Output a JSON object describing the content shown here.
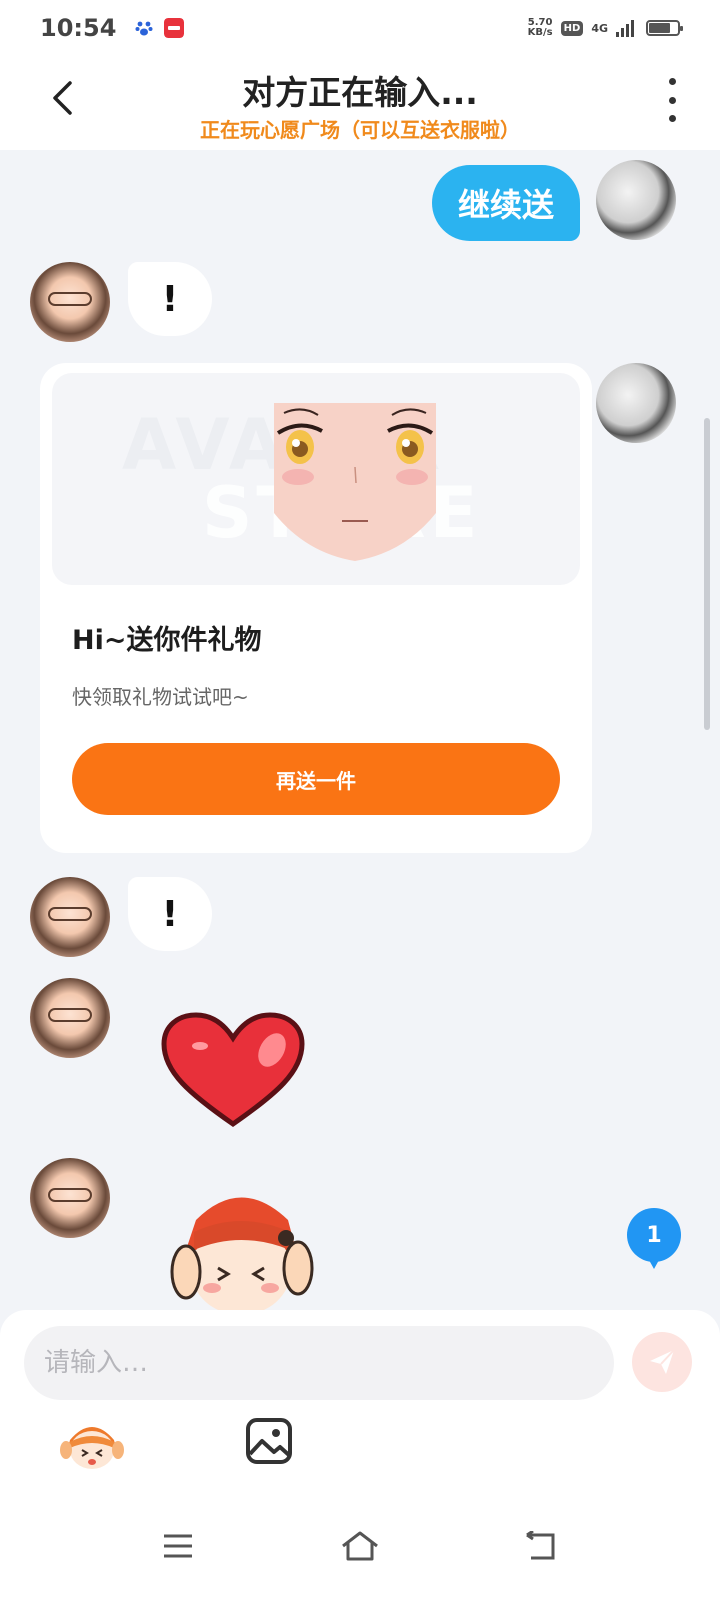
{
  "status_bar": {
    "time": "10:54",
    "net_speed_value": "5.70",
    "net_speed_unit": "KB/s",
    "hd": "HD",
    "network": "4G"
  },
  "header": {
    "title": "对方正在输入...",
    "subtitle": "正在玩心愿广场（可以互送衣服啦）"
  },
  "messages": {
    "self_text": "继续送",
    "other_text_1": "!",
    "other_text_2": "!"
  },
  "gift_card": {
    "watermark_line1": "AVATAR",
    "watermark_line2": "STORE",
    "title": "Hi~送你件礼物",
    "description": "快领取礼物试试吧~",
    "button_label": "再送一件"
  },
  "unread_count": "1",
  "input": {
    "placeholder": "请输入…",
    "value": ""
  },
  "colors": {
    "accent_blue": "#2bb3f0",
    "accent_orange": "#fa7414",
    "subtitle_orange": "#f08a1c"
  }
}
